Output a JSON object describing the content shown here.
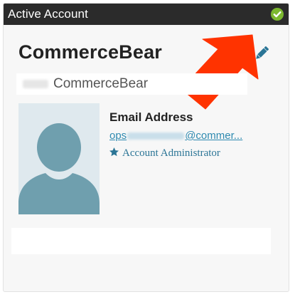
{
  "header": {
    "title": "Active Account",
    "status_icon": "check-circle-icon",
    "status_color": "#7cb82f"
  },
  "account": {
    "name": "CommerceBear",
    "subtitle_prefix": "SSR",
    "subtitle": "CommerceBear",
    "edit_icon": "pencil-icon",
    "accent_color": "#2e8ab0"
  },
  "annotation": {
    "arrow_color": "#ff3300"
  },
  "contact": {
    "label": "Email Address",
    "email_start": "ops",
    "email_hidden": "accounts",
    "email_end": "@commer...",
    "role_icon": "star-icon",
    "role": "Account Administrator"
  },
  "avatar": {
    "icon": "user-silhouette-icon",
    "color": "#6f9fae"
  }
}
